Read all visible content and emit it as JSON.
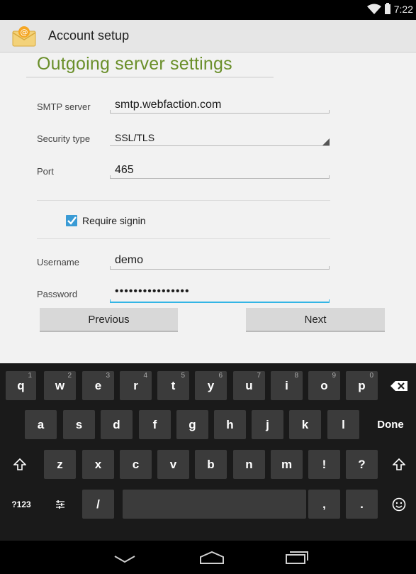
{
  "status_bar": {
    "time": "7:22"
  },
  "action_bar": {
    "title": "Account setup",
    "icon": "email-app-icon"
  },
  "heading": "Outgoing server settings",
  "fields": {
    "smtp_label": "SMTP server",
    "smtp_value": "smtp.webfaction.com",
    "security_label": "Security type",
    "security_value": "SSL/TLS",
    "port_label": "Port",
    "port_value": "465",
    "require_signin_label": "Require signin",
    "require_signin_checked": true,
    "username_label": "Username",
    "username_value": "demo",
    "password_label": "Password",
    "password_value": "••••••••••••••••"
  },
  "buttons": {
    "previous": "Previous",
    "next": "Next"
  },
  "keyboard": {
    "row1": [
      "q",
      "w",
      "e",
      "r",
      "t",
      "y",
      "u",
      "i",
      "o",
      "p"
    ],
    "row1_hints": [
      "1",
      "2",
      "3",
      "4",
      "5",
      "6",
      "7",
      "8",
      "9",
      "0"
    ],
    "row2": [
      "a",
      "s",
      "d",
      "f",
      "g",
      "h",
      "j",
      "k",
      "l"
    ],
    "done": "Done",
    "row3": [
      "z",
      "x",
      "c",
      "v",
      "b",
      "n",
      "m",
      "!",
      "?"
    ],
    "symbols": "?123",
    "slash": "/",
    "comma": ",",
    "period": "."
  },
  "colors": {
    "accent": "#33b5e5",
    "heading": "#6a8f2a",
    "checkbox": "#3a9bd5"
  }
}
